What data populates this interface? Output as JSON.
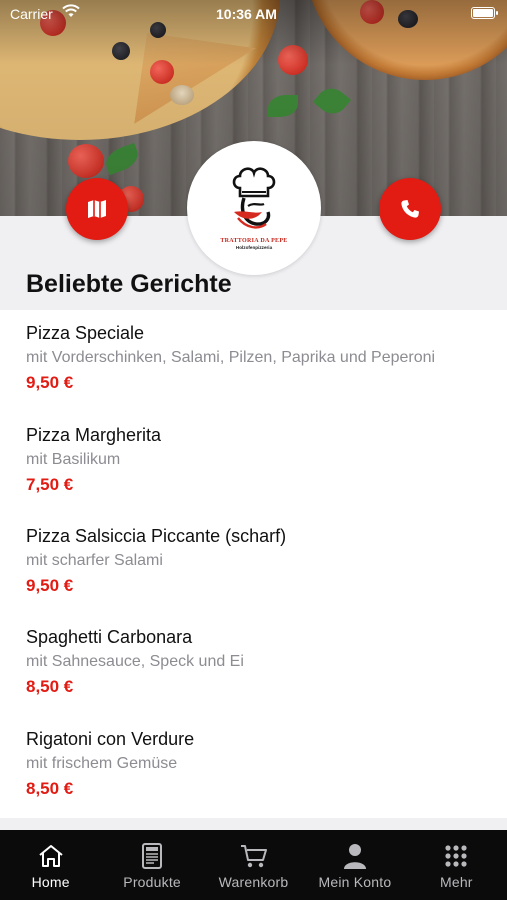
{
  "status_bar": {
    "carrier": "Carrier",
    "time": "10:36 AM"
  },
  "header": {
    "logo_title": "TRATTORIA DA PEPE",
    "logo_subtitle": "Holzofenpizzeria",
    "map_icon": "map-icon",
    "phone_icon": "phone-icon",
    "accent_color": "#e21b13"
  },
  "section": {
    "title": "Beliebte Gerichte"
  },
  "menu_items": [
    {
      "name": "Pizza Speciale",
      "description": "mit Vorderschinken, Salami, Pilzen, Paprika und Peperoni",
      "price": "9,50 €"
    },
    {
      "name": "Pizza Margherita",
      "description": "mit Basilikum",
      "price": "7,50 €"
    },
    {
      "name": "Pizza Salsiccia Piccante (scharf)",
      "description": "mit scharfer Salami",
      "price": "9,50 €"
    },
    {
      "name": "Spaghetti Carbonara",
      "description": "mit Sahnesauce, Speck und Ei",
      "price": "8,50 €"
    },
    {
      "name": "Rigatoni con Verdure",
      "description": "mit frischem Gemüse",
      "price": "8,50 €"
    }
  ],
  "tabbar": {
    "tabs": [
      {
        "label": "Home",
        "icon": "home-icon",
        "active": true
      },
      {
        "label": "Produkte",
        "icon": "menu-card-icon",
        "active": false
      },
      {
        "label": "Warenkorb",
        "icon": "cart-icon",
        "active": false
      },
      {
        "label": "Mein Konto",
        "icon": "user-icon",
        "active": false
      },
      {
        "label": "Mehr",
        "icon": "grid-icon",
        "active": false
      }
    ]
  }
}
